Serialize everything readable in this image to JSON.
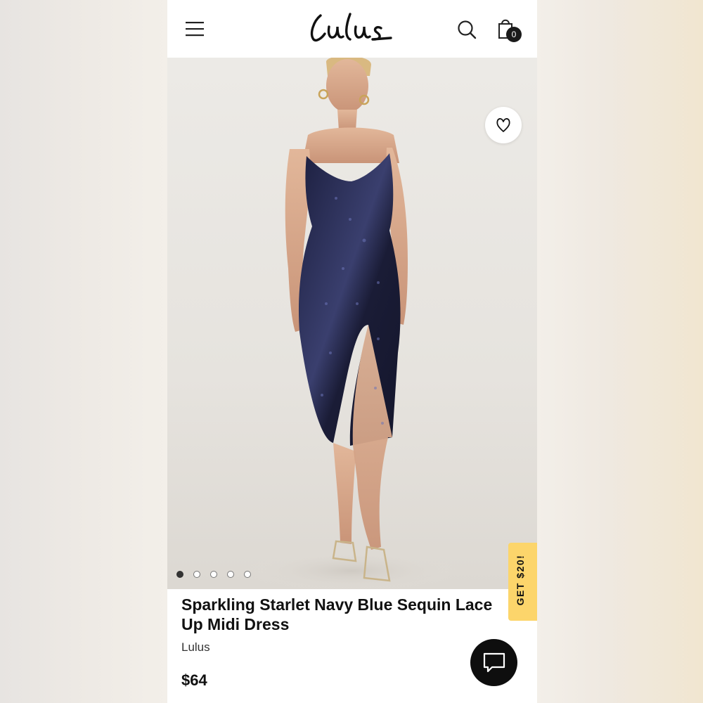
{
  "header": {
    "logo_text": "Lulus",
    "cart_count": "0"
  },
  "icons": {
    "menu": "hamburger-menu-icon",
    "search": "search-icon",
    "cart": "shopping-bag-icon",
    "wishlist": "heart-icon",
    "chat": "chat-bubble-icon"
  },
  "gallery": {
    "slide_count": 5,
    "active_index": 0
  },
  "promo": {
    "label": "GET $20!"
  },
  "product": {
    "title": "Sparkling Starlet Navy Blue Sequin Lace Up Midi Dress",
    "brand": "Lulus",
    "price": "$64"
  },
  "colors": {
    "promo_bg": "#fcd56b",
    "dress": "#1c1f3f",
    "text": "#111111",
    "chat_bg": "#0e0e0e"
  }
}
